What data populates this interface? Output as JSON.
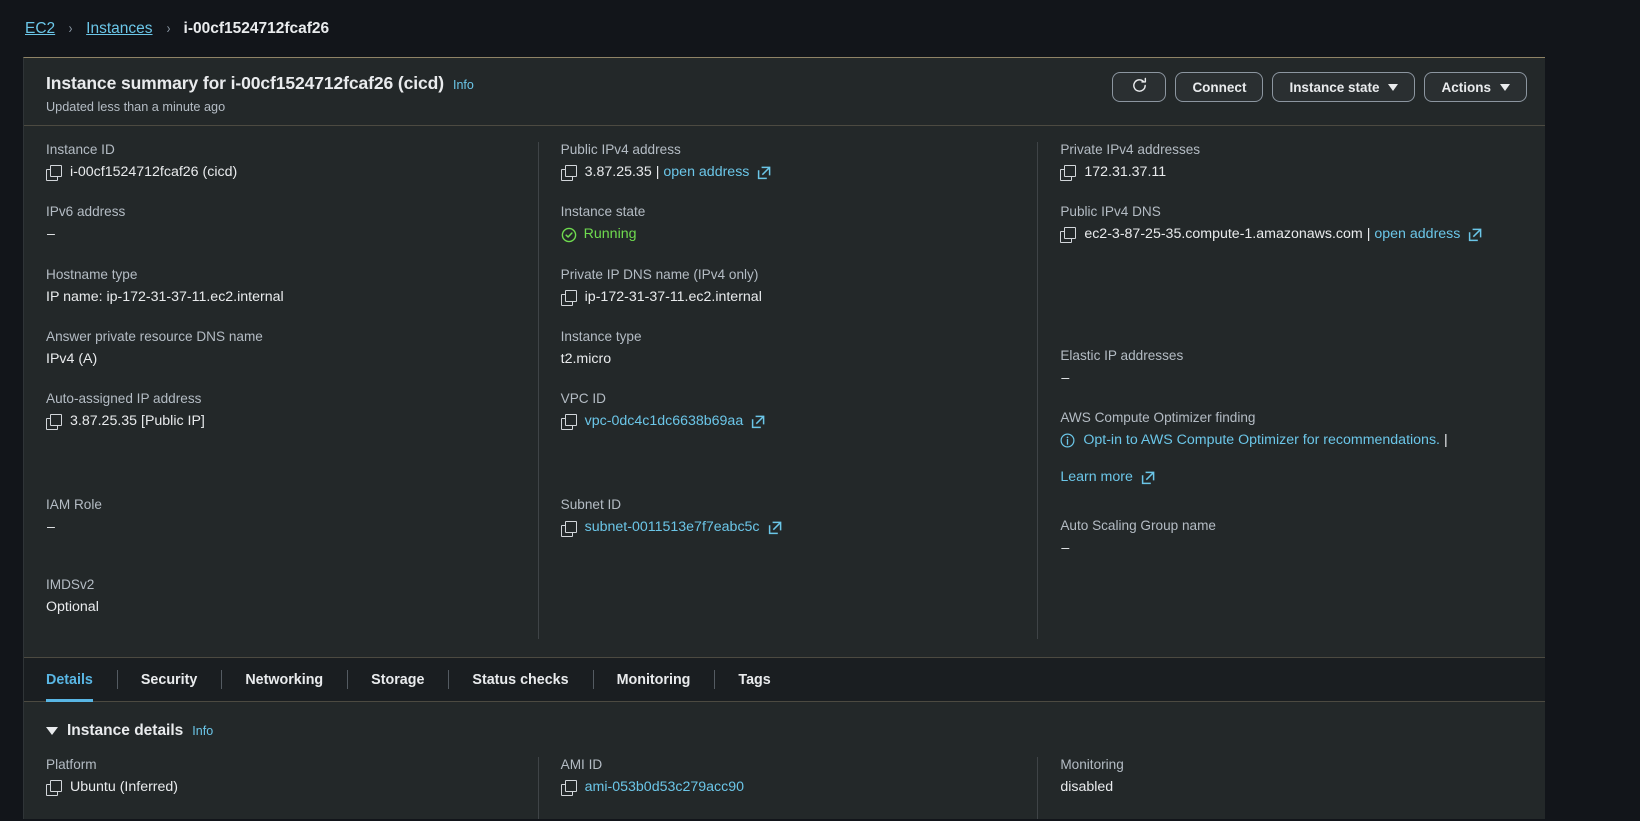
{
  "breadcrumb": {
    "items": [
      {
        "label": "EC2",
        "type": "link"
      },
      {
        "label": "Instances",
        "type": "link"
      },
      {
        "label": "i-00cf1524712fcaf26",
        "type": "current"
      }
    ],
    "separator": "›"
  },
  "header": {
    "title": "Instance summary for i-00cf1524712fcaf26 (cicd)",
    "info_label": "Info",
    "subtitle": "Updated less than a minute ago",
    "buttons": {
      "refresh_icon": "refresh-icon",
      "connect": "Connect",
      "instance_state": "Instance state",
      "actions": "Actions"
    }
  },
  "summary": {
    "col1": [
      {
        "label": "Instance ID",
        "value": "i-00cf1524712fcaf26 (cicd)",
        "copy": true,
        "kind": "text"
      },
      {
        "label": "IPv6 address",
        "value": "–",
        "copy": false,
        "kind": "text"
      },
      {
        "label": "Hostname type",
        "value": "IP name: ip-172-31-37-11.ec2.internal",
        "copy": false,
        "kind": "text"
      },
      {
        "label": "Answer private resource DNS name",
        "value": "IPv4 (A)",
        "copy": false,
        "kind": "text"
      },
      {
        "label": "Auto-assigned IP address",
        "value": "3.87.25.35 [Public IP]",
        "copy": true,
        "kind": "text"
      },
      {
        "label": "IAM Role",
        "value": "–",
        "copy": false,
        "kind": "text"
      },
      {
        "label": "IMDSv2",
        "value": "Optional",
        "copy": false,
        "kind": "text"
      }
    ],
    "col2": [
      {
        "label": "Public IPv4 address",
        "value": "3.87.25.35",
        "copy": true,
        "kind": "text-with-openlink",
        "link_label": "open address"
      },
      {
        "label": "Instance state",
        "value": "Running",
        "copy": false,
        "kind": "status"
      },
      {
        "label": "Private IP DNS name (IPv4 only)",
        "value": "ip-172-31-37-11.ec2.internal",
        "copy": true,
        "kind": "text"
      },
      {
        "label": "Instance type",
        "value": "t2.micro",
        "copy": false,
        "kind": "text"
      },
      {
        "label": "VPC ID",
        "value": "vpc-0dc4c1dc6638b69aa",
        "copy": true,
        "kind": "link"
      },
      {
        "label": "Subnet ID",
        "value": "subnet-0011513e7f7eabc5c",
        "copy": true,
        "kind": "link"
      }
    ],
    "col3": [
      {
        "label": "Private IPv4 addresses",
        "value": "172.31.37.11",
        "copy": true,
        "kind": "text"
      },
      {
        "label": "Public IPv4 DNS",
        "value": "ec2-3-87-25-35.compute-1.amazonaws.com",
        "copy": true,
        "kind": "text-with-openlink",
        "link_label": "open address"
      },
      {
        "label": "Elastic IP addresses",
        "value": "–",
        "copy": false,
        "kind": "text"
      },
      {
        "label": "AWS Compute Optimizer finding",
        "value": "Opt-in to AWS Compute Optimizer for recommendations.",
        "copy": false,
        "kind": "optimizer",
        "link2_label": "Learn more"
      },
      {
        "label": "Auto Scaling Group name",
        "value": "–",
        "copy": false,
        "kind": "text"
      }
    ]
  },
  "tabs": [
    {
      "label": "Details",
      "active": true
    },
    {
      "label": "Security",
      "active": false
    },
    {
      "label": "Networking",
      "active": false
    },
    {
      "label": "Storage",
      "active": false
    },
    {
      "label": "Status checks",
      "active": false
    },
    {
      "label": "Monitoring",
      "active": false
    },
    {
      "label": "Tags",
      "active": false
    }
  ],
  "instance_details": {
    "section_title": "Instance details",
    "info_label": "Info",
    "fields": [
      {
        "label": "Platform",
        "value": "Ubuntu (Inferred)",
        "copy": true,
        "kind": "text"
      },
      {
        "label": "AMI ID",
        "value": "ami-053b0d53c279acc90",
        "copy": true,
        "kind": "link"
      },
      {
        "label": "Monitoring",
        "value": "disabled",
        "copy": false,
        "kind": "text"
      }
    ]
  },
  "colors": {
    "page_bg": "#12151a",
    "card_bg": "#232829",
    "tab_bg": "#1a1e21",
    "link": "#6bc6e8",
    "accent_border": "#8f8366",
    "running_green": "#6fdb4f",
    "text_primary": "#e9ebed",
    "text_secondary": "#b4bcc4"
  }
}
